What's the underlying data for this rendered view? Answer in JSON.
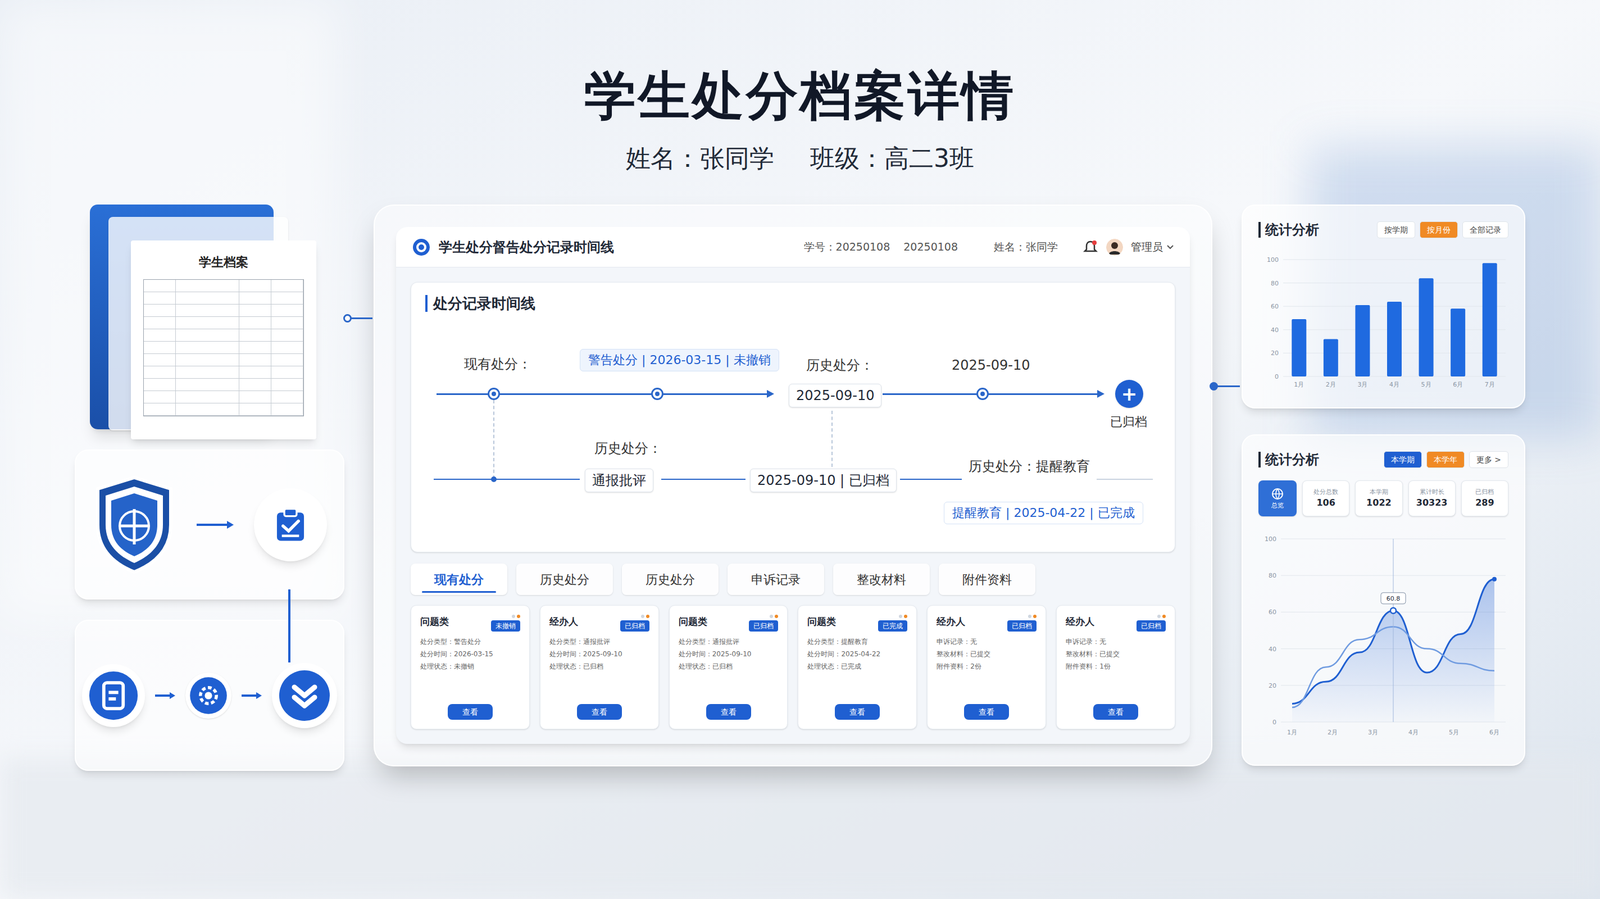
{
  "header": {
    "title": "学生处分档案详情",
    "name": "姓名：张同学",
    "class": "班级：高二3班"
  },
  "archive_doc": {
    "title": "学生档案"
  },
  "window": {
    "title": "学生处分督告处分记录时间线",
    "student_id": "学号：20250108",
    "student_id_2": "20250108",
    "student_name": "姓名：张同学",
    "user": "管理员"
  },
  "timeline": {
    "title": "处分记录时间线",
    "current_label": "现有处分：",
    "current_badge": "警告处分 | 2026-03-15 | 未撤销",
    "history_label_1": "历史处分：",
    "history_date_box": "2025-09-10",
    "history_date": "2025-09-10",
    "archived_icon": "+",
    "archived_label": "已归档",
    "history_label_2": "历史处分：",
    "notice_box": "通报批评",
    "archived_box": "2025-09-10 | 已归档",
    "reminder_label": "历史处分：提醒教育",
    "reminder_box": "提醒教育 | 2025-04-22 | 已完成"
  },
  "tabs": [
    {
      "label": "现有处分",
      "selected": true
    },
    {
      "label": "历史处分",
      "selected": false
    },
    {
      "label": "历史处分",
      "selected": false
    },
    {
      "label": "申诉记录",
      "selected": false
    },
    {
      "label": "整改材料",
      "selected": false
    },
    {
      "label": "附件资料",
      "selected": false
    }
  ],
  "cards": [
    {
      "title": "问题类",
      "badge": "未撤销",
      "lines": [
        "处分类型：警告处分",
        "处分时间：2026-03-15",
        "处理状态：未撤销"
      ],
      "button": "查看"
    },
    {
      "title": "经办人",
      "badge": "已归档",
      "lines": [
        "处分类型：通报批评",
        "处分时间：2025-09-10",
        "处理状态：已归档"
      ],
      "button": "查看"
    },
    {
      "title": "问题类",
      "badge": "已归档",
      "lines": [
        "处分类型：通报批评",
        "处分时间：2025-09-10",
        "处理状态：已归档"
      ],
      "button": "查看"
    },
    {
      "title": "问题类",
      "badge": "已完成",
      "lines": [
        "处分类型：提醒教育",
        "处分时间：2025-04-22",
        "处理状态：已完成"
      ],
      "button": "查看"
    },
    {
      "title": "经办人",
      "badge": "已归档",
      "lines": [
        "申诉记录：无",
        "整改材料：已提交",
        "附件资料：2份"
      ],
      "button": "查看"
    },
    {
      "title": "经办人",
      "badge": "已归档",
      "lines": [
        "申诉记录：无",
        "整改材料：已提交",
        "附件资料：1份"
      ],
      "button": "查看"
    }
  ],
  "stats_top": {
    "title": "统计分析",
    "filters": [
      {
        "label": "按学期",
        "color": "#ffffff"
      },
      {
        "label": "按月份",
        "color": "#f08a24"
      },
      {
        "label": "全部记录",
        "color": "#ffffff"
      }
    ],
    "chart": {
      "ticks": [
        "100",
        "80",
        "60",
        "40",
        "20",
        "0"
      ],
      "labels": [
        "1月",
        "2月",
        "3月",
        "4月",
        "5月",
        "6月",
        "7月"
      ],
      "values": [
        49,
        32,
        61,
        64,
        84,
        58,
        97
      ]
    }
  },
  "stats_bottom": {
    "title": "统计分析",
    "filters": [
      {
        "label": "本学期",
        "color": "#1f5fd1"
      },
      {
        "label": "本学年",
        "color": "#f08a24"
      },
      {
        "label": "更多 >",
        "color": "#ffffff"
      }
    ],
    "metrics": [
      {
        "kind": "icon",
        "label": "总览"
      },
      {
        "kind": "number",
        "label": "处分总数",
        "value": "106"
      },
      {
        "kind": "number",
        "label": "本学期",
        "value": "1022"
      },
      {
        "kind": "number",
        "label": "累计时长",
        "value": "30323"
      },
      {
        "kind": "number",
        "label": "已归档",
        "value": "289"
      }
    ],
    "chart": {
      "ticks": [
        "100",
        "80",
        "60",
        "40",
        "20",
        "0"
      ],
      "labels": [
        "1月",
        "2月",
        "3月",
        "4月",
        "5月",
        "6月"
      ],
      "series": [
        {
          "values": [
            10,
            22,
            38,
            60.8,
            27,
            48,
            78
          ],
          "color": "#1f5fd1"
        },
        {
          "values": [
            8,
            30,
            45,
            52,
            40,
            32,
            28
          ],
          "color": "#6f9be0"
        }
      ],
      "tooltip": {
        "text": "60.8",
        "series": 0,
        "index": 3
      }
    }
  }
}
